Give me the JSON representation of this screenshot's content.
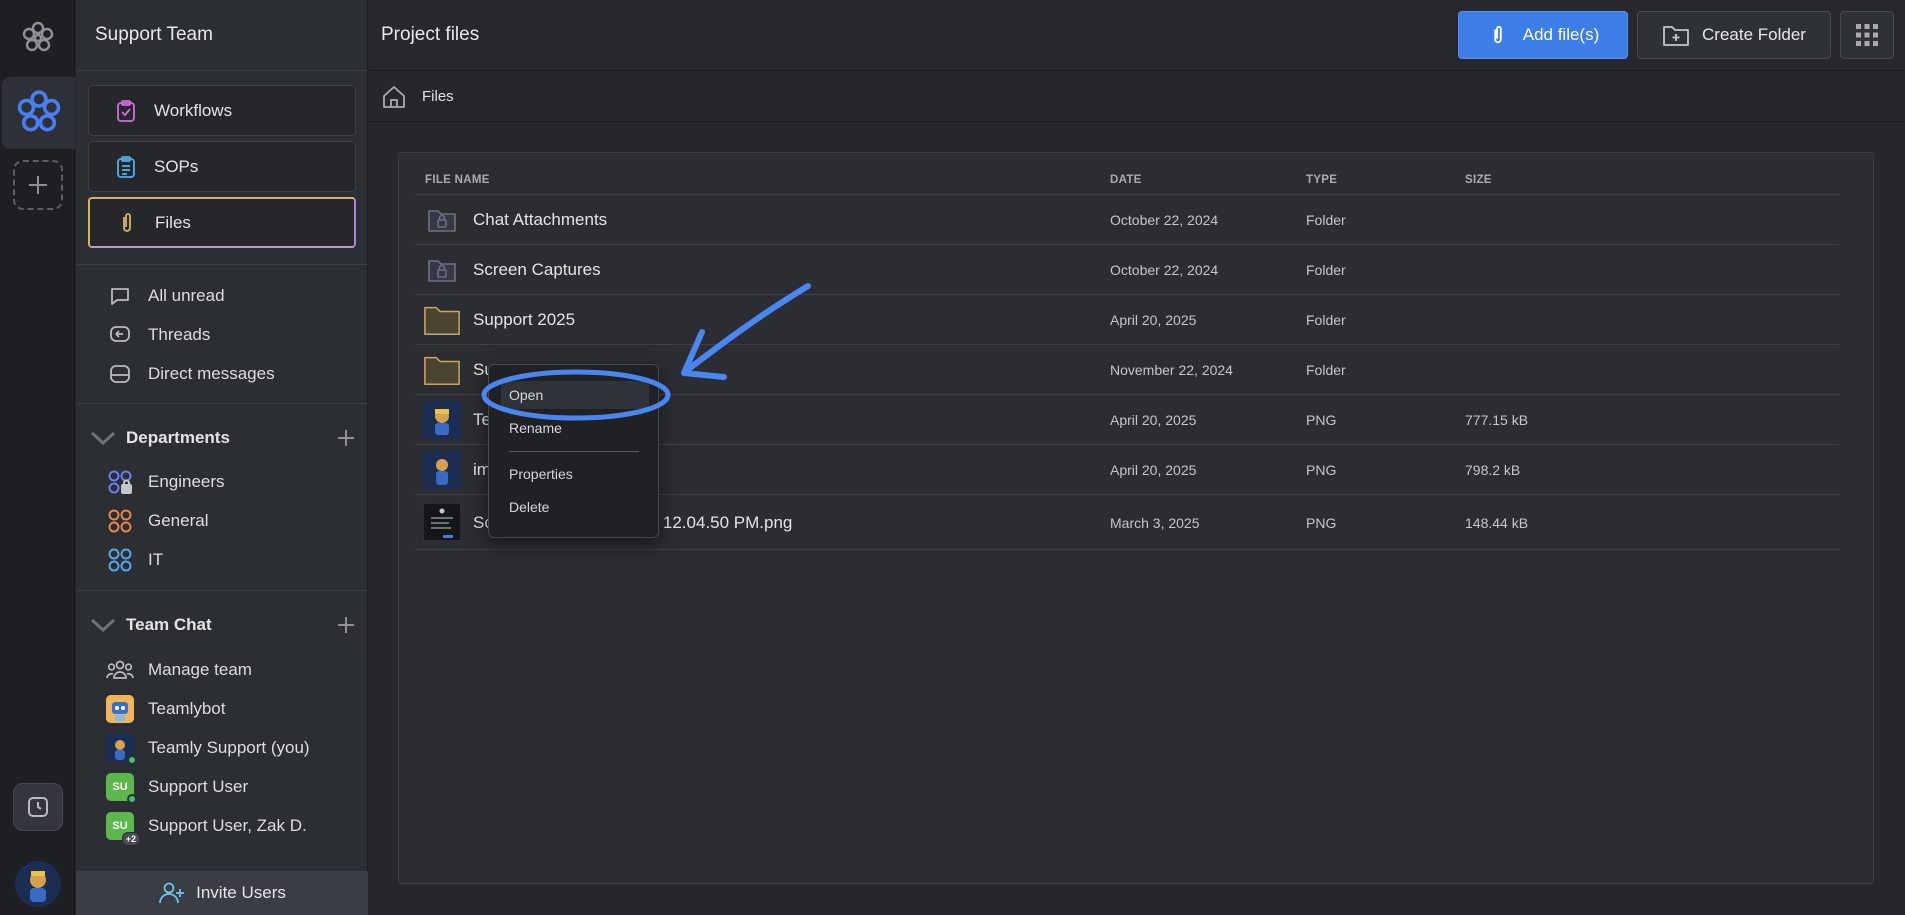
{
  "rail": {
    "logo_icon": "flower-logo-icon",
    "workspace_icon": "flower-workspace-icon",
    "add_workspace_icon": "plus-icon",
    "history_icon": "clock-icon"
  },
  "sidebar": {
    "team_title": "Support Team",
    "nav": [
      {
        "label": "Workflows",
        "icon": "clipboard-check-icon",
        "color": "#d16ee0"
      },
      {
        "label": "SOPs",
        "icon": "clipboard-list-icon",
        "color": "#4fb0e8"
      },
      {
        "label": "Files",
        "icon": "paperclip-icon",
        "color": "#d9b26a"
      }
    ],
    "inbox": [
      {
        "label": "All unread",
        "icon": "message-square-icon"
      },
      {
        "label": "Threads",
        "icon": "reply-icon"
      },
      {
        "label": "Direct messages",
        "icon": "inbox-icon"
      }
    ],
    "departments": {
      "label": "Departments",
      "items": [
        {
          "label": "Engineers",
          "color": "#6b7ff0"
        },
        {
          "label": "General",
          "color": "#e8874a"
        },
        {
          "label": "IT",
          "color": "#5aa7e8"
        }
      ]
    },
    "team_chat": {
      "label": "Team Chat",
      "items": [
        {
          "label": "Manage team",
          "icon": "users-icon"
        },
        {
          "label": "Teamlybot",
          "icon": "bot-avatar"
        },
        {
          "label": "Teamly Support (you)",
          "icon": "user-avatar"
        },
        {
          "label": "Support User",
          "initials": "SU"
        },
        {
          "label": "Support User, Zak D.",
          "initials": "SU",
          "extra": "+2"
        }
      ]
    },
    "invite_label": "Invite Users"
  },
  "topbar": {
    "title": "Project files",
    "add_files": "Add file(s)",
    "create_folder": "Create Folder"
  },
  "breadcrumb": {
    "label": "Files"
  },
  "table": {
    "headers": {
      "name": "FILE NAME",
      "date": "DATE",
      "type": "TYPE",
      "size": "SIZE"
    },
    "rows": [
      {
        "name": "Chat Attachments",
        "date": "October 22, 2024",
        "type": "Folder",
        "size": "",
        "icon": "locked-folder-icon"
      },
      {
        "name": "Screen Captures",
        "date": "October 22, 2024",
        "type": "Folder",
        "size": "",
        "icon": "locked-folder-icon"
      },
      {
        "name": "Support 2025",
        "date": "April 20, 2025",
        "type": "Folder",
        "size": "",
        "icon": "folder-icon"
      },
      {
        "name": "Su",
        "date": "November 22, 2024",
        "type": "Folder",
        "size": "",
        "icon": "folder-icon"
      },
      {
        "name": "Te",
        "date": "April 20, 2025",
        "type": "PNG",
        "size": "777.15 kB",
        "icon": "image-thumbnail"
      },
      {
        "name": "im",
        "date": "April 20, 2025",
        "type": "PNG",
        "size": "798.2 kB",
        "icon": "image-thumbnail"
      },
      {
        "name": "Sc",
        "name_tail": "at 12.04.50 PM.png",
        "date": "March 3, 2025",
        "type": "PNG",
        "size": "148.44 kB",
        "icon": "screenshot-thumbnail"
      }
    ]
  },
  "context_menu": {
    "items": [
      "Open",
      "Rename",
      "Properties",
      "Delete"
    ]
  },
  "annotation": {
    "color": "#4a86f0"
  }
}
